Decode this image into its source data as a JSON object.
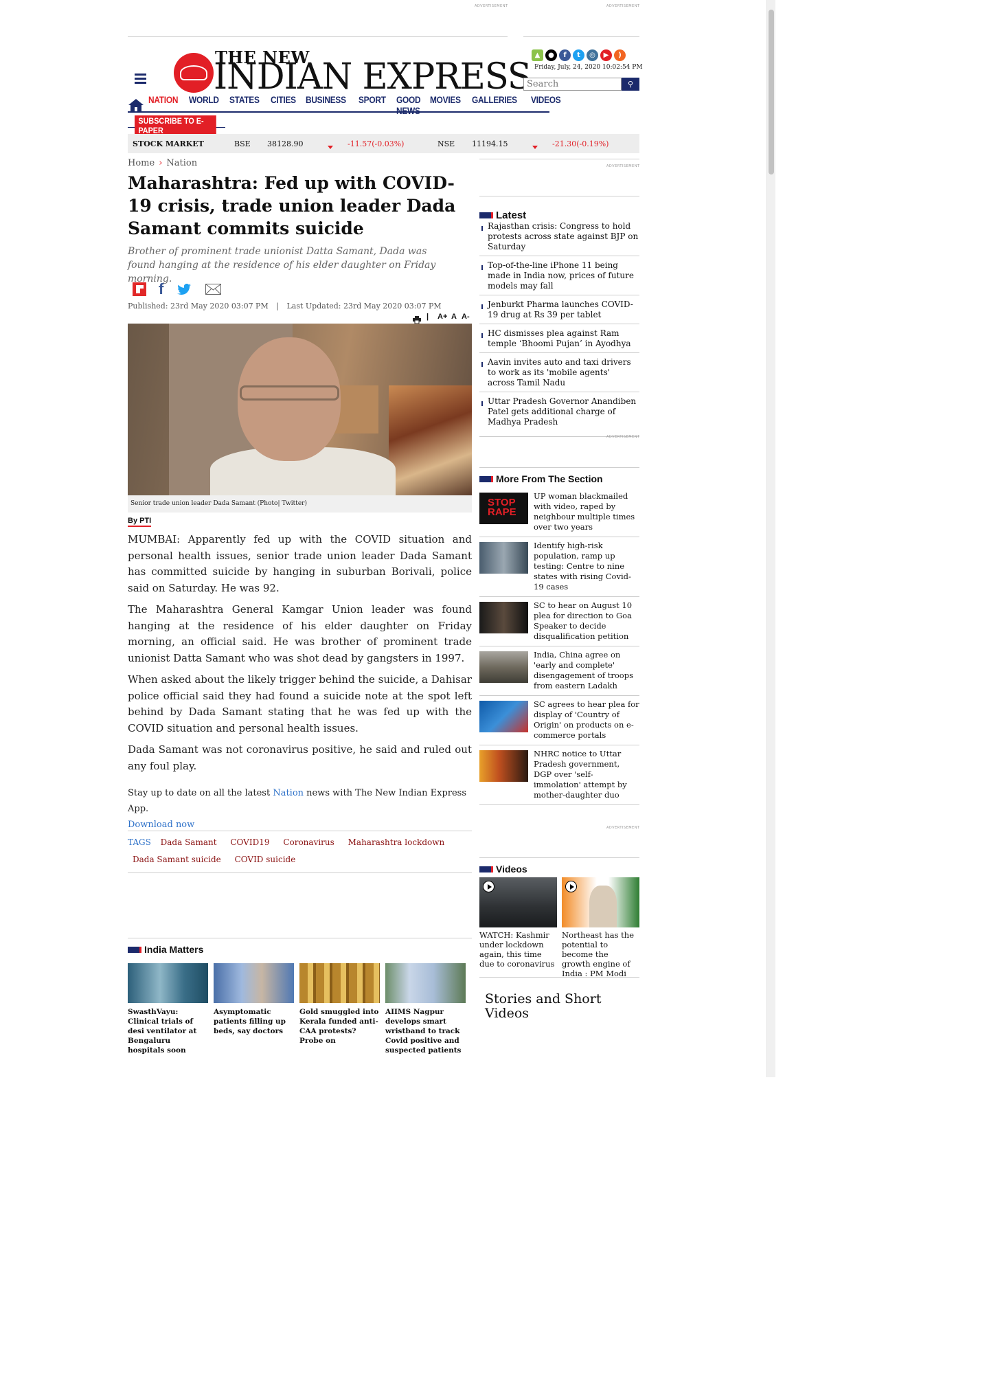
{
  "ads": {
    "label": "ADVERTISEMENT"
  },
  "header": {
    "logo_top": "THE NEW",
    "logo_main": "INDIAN EXPRESS",
    "date": "Friday, July, 24, 2020  10:02:54 PM",
    "search_placeholder": "Search",
    "social_icons": [
      "android-icon",
      "apple-icon",
      "facebook-icon",
      "twitter-icon",
      "instagram-icon",
      "youtube-icon",
      "rss-icon"
    ]
  },
  "nav": {
    "items": [
      "NATION",
      "WORLD",
      "STATES",
      "CITIES",
      "BUSINESS",
      "SPORT",
      "GOOD NEWS",
      "MOVIES",
      "GALLERIES",
      "VIDEOS"
    ],
    "active": "NATION",
    "subscribe": "SUBSCRIBE TO E-PAPER"
  },
  "stock": {
    "label": "STOCK MARKET",
    "bse": {
      "name": "BSE",
      "value": "38128.90",
      "change": "-11.57(-0.03%)"
    },
    "nse": {
      "name": "NSE",
      "value": "11194.15",
      "change": "-21.30(-0.19%)"
    }
  },
  "breadcrumb": {
    "home": "Home",
    "section": "Nation",
    "sep": "›"
  },
  "article": {
    "title": "Maharashtra: Fed up with COVID-19 crisis, trade union leader Dada Samant commits suicide",
    "subtitle": "Brother of prominent trade unionist Datta Samant, Dada was found hanging at the residence of his elder daughter on Friday morning.",
    "published": "Published: 23rd May 2020 03:07 PM",
    "pub_sep": "|",
    "updated": "Last Updated: 23rd May 2020 03:07 PM",
    "tools": {
      "sep": "|",
      "a_plus": "A+",
      "a": "A",
      "a_minus": "A-"
    },
    "caption": "Senior trade union leader Dada Samant (Photo| Twitter)",
    "byline": "By PTI",
    "paragraphs": [
      "MUMBAI: Apparently fed up with the COVID situation and personal health issues, senior trade union leader Dada Samant has committed suicide by hanging in suburban Borivali, police said on Saturday. He was 92.",
      "The Maharashtra General Kamgar Union leader was found hanging at the residence of his elder daughter on Friday morning, an official said. He was brother of prominent trade unionist Datta Samant who was shot dead by gangsters in 1997.",
      "When asked about the likely trigger behind the suicide, a Dahisar police official said they had found a suicide note at the spot left behind by Dada Samant stating that he was fed up with the COVID situation and personal health issues.",
      "Dada Samant was not coronavirus positive, he said and ruled out any foul play."
    ],
    "stay_pre": "Stay up to date on all the latest",
    "stay_link": "Nation",
    "stay_post": "news with The New Indian Express App.",
    "download": "Download now",
    "tags_label": "TAGS",
    "tags": [
      "Dada Samant",
      "COVID19",
      "Coronavirus",
      "Maharashtra lockdown",
      "Dada Samant suicide",
      "COVID suicide"
    ]
  },
  "india_matters": {
    "title": "India Matters",
    "items": [
      "SwasthVayu: Clinical trials of desi ventilator at Bengaluru hospitals soon",
      "Asymptomatic patients filling up beds, say doctors",
      "Gold smuggled into Kerala funded anti-CAA protests? Probe on",
      "AIIMS Nagpur develops smart wristband to track Covid positive and suspected patients"
    ]
  },
  "latest": {
    "title": "Latest",
    "items": [
      "Rajasthan crisis: Congress to hold protests across state against BJP on Saturday",
      "Top-of-the-line iPhone 11 being made in India now, prices of future models may fall",
      "Jenburkt Pharma launches COVID-19 drug at Rs 39 per tablet",
      "HC dismisses plea against Ram temple ‘Bhoomi Pujan’ in Ayodhya",
      "Aavin invites auto and taxi drivers to work as its 'mobile agents' across Tamil Nadu",
      "Uttar Pradesh Governor Anandiben Patel gets additional charge of Madhya Pradesh"
    ]
  },
  "more_section": {
    "title": "More From The Section",
    "thumb_text": [
      "STOP",
      "RAPE"
    ],
    "items": [
      "UP woman blackmailed with video, raped by neighbour multiple times over two years",
      "Identify high-risk population, ramp up testing: Centre to nine states with rising Covid-19 cases",
      "SC to hear on August 10 plea for direction to Goa Speaker to decide disqualification petition",
      "India, China agree on 'early and complete' disengagement of troops from eastern Ladakh",
      "SC agrees to hear plea for display of 'Country of Origin' on products on e-commerce portals",
      "NHRC notice to Uttar Pradesh government, DGP over 'self-immolation' attempt by mother-daughter duo"
    ]
  },
  "videos": {
    "title": "Videos",
    "items": [
      "WATCH: Kashmir under lockdown again, this time due to coronavirus",
      "Northeast has the potential to become the growth engine of India : PM Modi"
    ]
  },
  "stories": {
    "title": "Stories and Short Videos"
  }
}
